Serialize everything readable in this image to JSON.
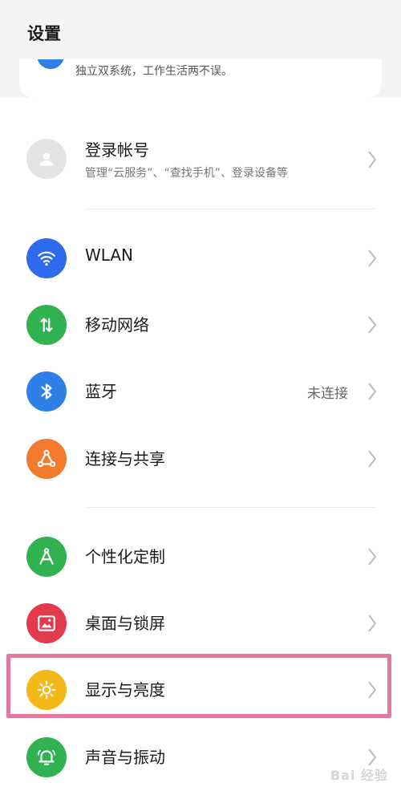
{
  "header": {
    "title": "设置"
  },
  "promo": {
    "description": "独立双系统，工作生活两不误。"
  },
  "account": {
    "title": "登录帐号",
    "subtitle": "管理“云服务”、“查找手机”、登录设备等",
    "icon": "user-icon"
  },
  "items": [
    {
      "label": "WLAN",
      "icon": "wifi-icon",
      "color": "#2f6bef"
    },
    {
      "label": "移动网络",
      "icon": "mobile-data-icon",
      "color": "#2fb24f"
    },
    {
      "label": "蓝牙",
      "value": "未连接",
      "icon": "bluetooth-icon",
      "color": "#2f80e6"
    },
    {
      "label": "连接与共享",
      "icon": "share-icon",
      "color": "#f27a2c"
    },
    {
      "label": "个性化定制",
      "icon": "compass-icon",
      "color": "#2fb24f"
    },
    {
      "label": "桌面与锁屏",
      "icon": "image-icon",
      "color": "#e23c4c"
    },
    {
      "label": "显示与亮度",
      "icon": "brightness-icon",
      "color": "#f5b819"
    },
    {
      "label": "声音与振动",
      "icon": "bell-icon",
      "color": "#2fb24f"
    }
  ],
  "colors": {
    "highlight": "#e8779c",
    "background": "#f4f4f4"
  },
  "watermark": {
    "text": "Bai 经验"
  }
}
